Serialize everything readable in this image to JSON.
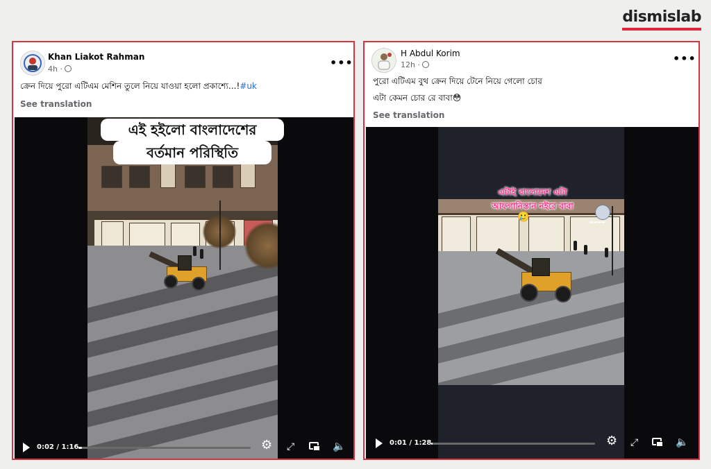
{
  "brand": {
    "name": "dismislab"
  },
  "posts": [
    {
      "author": "Khan Liakot Rahman",
      "time": "4h",
      "caption": "ক্রেন দিয়ে পুরো এটিএম মেশিন তুলে নিয়ে যাওয়া হলো প্রকাশ্যে...!",
      "hashtag": "#uk",
      "see_translation": "See translation",
      "overlay_line1": "এই হইলো বাংলাদেশের",
      "overlay_line2": "বর্তমান পরিস্থিতি",
      "video_time": "0:02 / 1:16",
      "progress": 0.02,
      "more_label": "•••"
    },
    {
      "author": "H Abdul Korim",
      "time": "12h",
      "caption_line1": "পুরো এটিএম বুথ ক্রেন দিয়ে টেনে নিয়ে গেলো চোর",
      "caption_line2": "এটা কেমন চোর রে বাবা😳",
      "see_translation": "See translation",
      "overlay_line1": "এটাই বাংলাদেশ এটা",
      "overlay_line2": "আফগানিস্তান নইরে বাবা",
      "overlay_emoji": "🥲",
      "video_time": "0:01 / 1:28",
      "progress": 0.01,
      "more_label": "•••"
    }
  ],
  "icons": [
    "play-icon",
    "settings-gear-icon",
    "fullscreen-icon",
    "picture-in-picture-icon",
    "mute-icon",
    "globe-icon",
    "more-options-icon"
  ],
  "colors": {
    "border_red": "#d7323f",
    "brand_red": "#e0263c",
    "hashtag_blue": "#216fdb",
    "overlay_pink": "#ff2f8e"
  }
}
